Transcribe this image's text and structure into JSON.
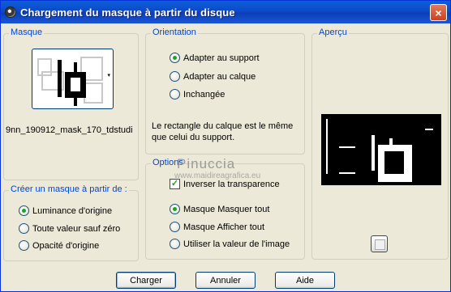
{
  "window": {
    "title": "Chargement du masque à partir du disque",
    "close_label": "×"
  },
  "mask_group": {
    "label": "Masque",
    "mask_name": "9nn_190912_mask_170_tdstudi",
    "dropdown_arrow": "▾"
  },
  "create_group": {
    "label": "Créer un masque à partir de :",
    "options": [
      {
        "label": "Luminance d'origine",
        "checked": true
      },
      {
        "label": "Toute valeur sauf zéro",
        "checked": false
      },
      {
        "label": "Opacité d'origine",
        "checked": false
      }
    ]
  },
  "orientation_group": {
    "label": "Orientation",
    "options": [
      {
        "label": "Adapter au support",
        "checked": true
      },
      {
        "label": "Adapter au calque",
        "checked": false
      },
      {
        "label": "Inchangée",
        "checked": false
      }
    ],
    "note": "Le rectangle du calque est le même que celui du support."
  },
  "options_group": {
    "label": "Options",
    "invert": {
      "label": "Inverser la transparence",
      "checked": true,
      "mark": "✓"
    },
    "options": [
      {
        "label": "Masque Masquer tout",
        "checked": true
      },
      {
        "label": "Masque Afficher tout",
        "checked": false
      },
      {
        "label": "Utiliser la valeur de l'image",
        "checked": false
      }
    ]
  },
  "preview_group": {
    "label": "Aperçu"
  },
  "watermark": {
    "line1": "Pinuccia",
    "line2": "www.maidireagrafica.eu"
  },
  "buttons": {
    "load": "Charger",
    "cancel": "Annuler",
    "help": "Aide"
  }
}
